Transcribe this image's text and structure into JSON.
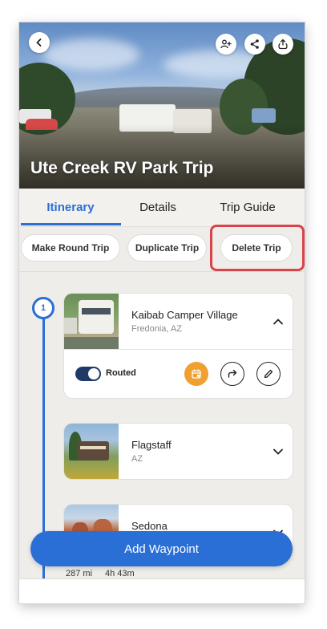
{
  "header": {
    "trip_title": "Ute Creek RV Park Trip",
    "icons": [
      "chevron-left-icon",
      "add-person-icon",
      "share-icon",
      "export-icon"
    ]
  },
  "tabs": [
    {
      "label": "Itinerary",
      "active": true
    },
    {
      "label": "Details",
      "active": false
    },
    {
      "label": "Trip Guide",
      "active": false
    }
  ],
  "actions": {
    "round_trip": "Make Round Trip",
    "duplicate": "Duplicate Trip",
    "delete": "Delete Trip"
  },
  "timeline": {
    "step_number": "1"
  },
  "waypoints": [
    {
      "name": "Kaibab Camper Village",
      "location": "Fredonia, AZ",
      "expanded": true,
      "routed_label": "Routed",
      "routed_on": true
    },
    {
      "name": "Flagstaff",
      "location": "AZ",
      "expanded": false
    },
    {
      "name": "Sedona",
      "location": "",
      "expanded": false
    }
  ],
  "footer": {
    "add_waypoint": "Add Waypoint",
    "distance": "287 mi",
    "duration": "4h 43m"
  },
  "colors": {
    "accent": "#2a6fd6",
    "highlight": "#d9434a",
    "calendar_button": "#f0a030",
    "toggle": "#1f3a66"
  }
}
